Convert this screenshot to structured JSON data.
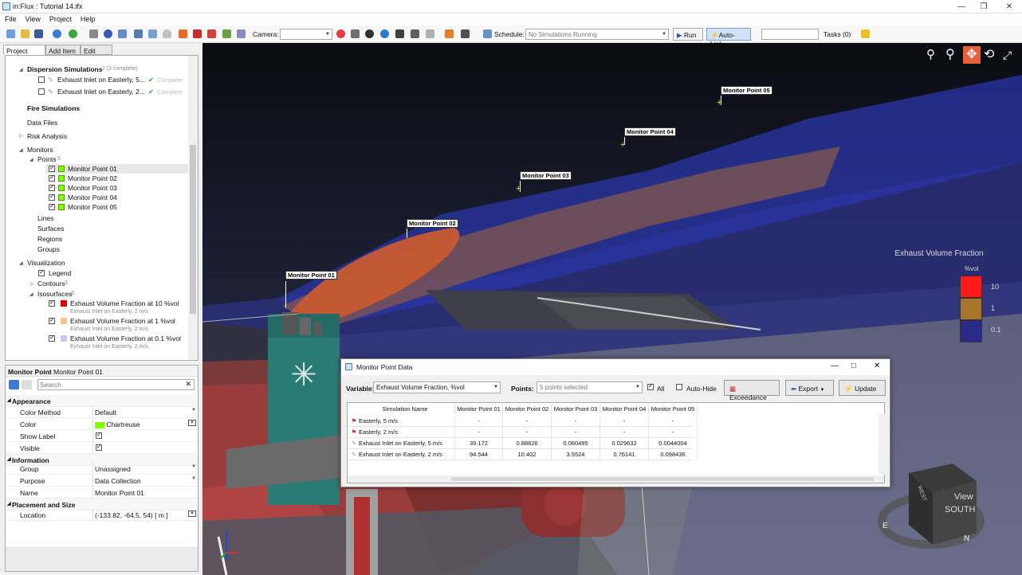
{
  "window": {
    "title": "in:Flux : Tutorial 14.ifx"
  },
  "menu": [
    "File",
    "View",
    "Project",
    "Help"
  ],
  "toolbar": {
    "camera_label": "Camera:",
    "camera_value": "",
    "schedule_label": "Schedule:",
    "schedule_value": "No Simulations Running",
    "run_label": "Run",
    "autolink_label": "Auto-Link",
    "tasks_label": "Tasks (0)"
  },
  "tabs": [
    "Project Items",
    "Add Item",
    "Edit Item"
  ],
  "tree": {
    "dispersion": {
      "label": "Dispersion Simulations",
      "count": "2 (2 complete)"
    },
    "sims": [
      {
        "label": "Exhaust Inlet on Easterly, 5...",
        "status": "Complete"
      },
      {
        "label": "Exhaust Inlet on Easterly, 2...",
        "status": "Complete"
      }
    ],
    "fire": "Fire Simulations",
    "datafiles": "Data Files",
    "risk": "Risk Analysis",
    "monitors": "Monitors",
    "points": {
      "label": "Points",
      "count": "5"
    },
    "monitor_points": [
      {
        "label": "Monitor Point 01"
      },
      {
        "label": "Monitor Point 02"
      },
      {
        "label": "Monitor Point 03"
      },
      {
        "label": "Monitor Point 04"
      },
      {
        "label": "Monitor Point 05"
      }
    ],
    "lines": "Lines",
    "surfaces": "Surfaces",
    "regions": "Regions",
    "groups": "Groups",
    "visualization": "Visualization",
    "legend": "Legend",
    "contours": {
      "label": "Contours",
      "count": "3"
    },
    "isosurfaces": {
      "label": "Isosurfaces",
      "count": "3"
    },
    "iso_items": [
      {
        "label": "Exhaust Volume Fraction at 10 %vol",
        "sub": "Exhaust Inlet on Easterly, 2 m/s",
        "color": "#e00000"
      },
      {
        "label": "Exhaust Volume Fraction at 1 %vol",
        "sub": "Exhaust Inlet on Easterly, 2 m/s",
        "color": "#f3c48c"
      },
      {
        "label": "Exhaust Volume Fraction at 0.1 %vol",
        "sub": "Exhaust Inlet on Easterly, 2 m/s",
        "color": "#c8c8f0"
      }
    ]
  },
  "props": {
    "header_type": "Monitor Point",
    "header_name": "Monitor Point 01",
    "search_placeholder": "Search",
    "cat_appearance": "Appearance",
    "color_method_k": "Color Method",
    "color_method_v": "Default",
    "color_k": "Color",
    "color_v": "Chartreuse",
    "color_hex": "#7fff00",
    "show_label_k": "Show Label",
    "visible_k": "Visible",
    "cat_information": "Information",
    "group_k": "Group",
    "group_v": "Unassigned",
    "purpose_k": "Purpose",
    "purpose_v": "Data Collection",
    "name_k": "Name",
    "name_v": "Monitor Point 01",
    "cat_placement": "Placement and Size",
    "location_k": "Location",
    "location_v": "(-133.82, -64.5, 54) [ m ]"
  },
  "scene": {
    "labels": [
      "Monitor Point 01",
      "Monitor Point 02",
      "Monitor Point 03",
      "Monitor Point 04",
      "Monitor Point 05"
    ],
    "cube_view": "View",
    "cube_face": "SOUTH",
    "cube_west": "WEST",
    "compass_n": "N",
    "compass_e": "E"
  },
  "legend": {
    "title": "Exhaust Volume Fraction",
    "unit": "%vol",
    "values": [
      "10",
      "1",
      "0.1"
    ],
    "colors": [
      "#ff1a1a",
      "#a8762a",
      "#2a2a8a"
    ]
  },
  "dialog": {
    "title": "Monitor Point Data",
    "variable_label": "Variable:",
    "variable_value": "Exhaust Volume Fraction, %vol",
    "points_label": "Points:",
    "points_value": "5 points selected",
    "all_label": "All",
    "autohide_label": "Auto-Hide",
    "exceedance_label": "Exceedance",
    "export_label": "Export",
    "update_label": "Update",
    "columns": [
      "Simulation Name",
      "Monitor Point 01",
      "Monitor Point 02",
      "Monitor Point 03",
      "Monitor Point 04",
      "Monitor Point 05"
    ],
    "rows": [
      [
        "Easterly, 5 m/s",
        "-",
        "-",
        "-",
        "-",
        "-"
      ],
      [
        "Easterly, 2 m/s",
        "-",
        "-",
        "-",
        "-",
        "-"
      ],
      [
        "Exhaust Inlet on Easterly, 5 m/s",
        "39.172",
        "0.88826",
        "0.060495",
        "0.029632",
        "0.0044004"
      ],
      [
        "Exhaust Inlet on Easterly, 2 m/s",
        "94.544",
        "10.402",
        "3.5524",
        "0.76141",
        "0.098436"
      ]
    ]
  }
}
